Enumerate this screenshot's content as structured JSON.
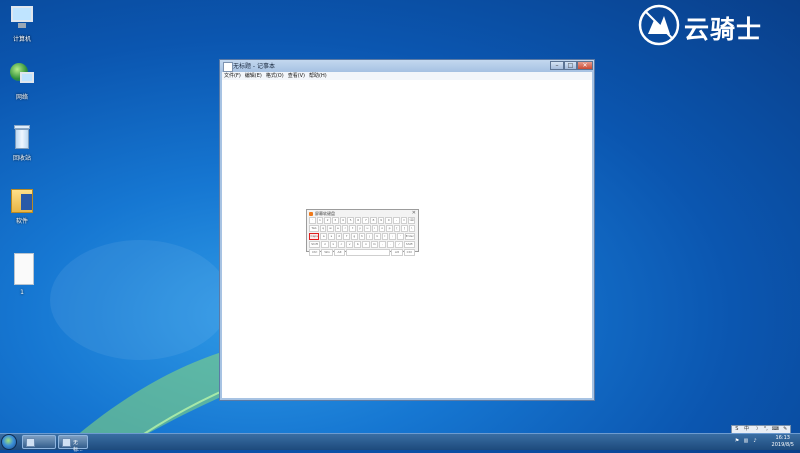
{
  "desktop": {
    "icons": [
      {
        "label": "计算机",
        "icon": "computer-icon"
      },
      {
        "label": "网络",
        "icon": "network-icon"
      },
      {
        "label": "回收站",
        "icon": "recycle-bin-icon"
      },
      {
        "label": "软件",
        "icon": "folder-icon"
      },
      {
        "label": "1",
        "icon": "text-file-icon"
      }
    ]
  },
  "watermark": {
    "text": "云骑士"
  },
  "notepad": {
    "title": "无标题 - 记事本",
    "menu": [
      "文件(F)",
      "编辑(E)",
      "格式(O)",
      "查看(V)",
      "帮助(H)"
    ],
    "controls": {
      "minimize": "–",
      "maximize": "□",
      "close": "✕"
    }
  },
  "osk": {
    "title": "屏幕软键盘",
    "close": "✕",
    "rows": [
      [
        "`",
        "1",
        "2",
        "3",
        "4",
        "5",
        "6",
        "7",
        "8",
        "9",
        "0",
        "-",
        "=",
        "⌫"
      ],
      [
        "Tab",
        "q",
        "w",
        "e",
        "r",
        "t",
        "y",
        "u",
        "i",
        "o",
        "p",
        "[",
        "]",
        "\\"
      ],
      [
        "Caps",
        "a",
        "s",
        "d",
        "f",
        "g",
        "h",
        "j",
        "k",
        "l",
        ";",
        "'",
        "Enter"
      ],
      [
        "Shift",
        "z",
        "x",
        "c",
        "v",
        "b",
        "n",
        "m",
        ",",
        ".",
        "/",
        "Shift"
      ],
      [
        "Ctrl",
        "Win",
        "Alt",
        "",
        "Alt",
        "Ctrl"
      ]
    ],
    "highlighted_key": "Caps"
  },
  "taskbar": {
    "buttons": [
      {
        "label": "",
        "icon": "explorer-icon"
      },
      {
        "label": "无标...",
        "icon": "notepad-icon"
      }
    ],
    "tray_icons": [
      "flag-icon",
      "network-tray-icon",
      "volume-icon"
    ],
    "clock": {
      "time": "16:13",
      "date": "2019/8/5"
    }
  },
  "colors": {
    "accent": "#0b56b0",
    "taskbar": "#1d4a7c",
    "highlight": "#e02020"
  }
}
